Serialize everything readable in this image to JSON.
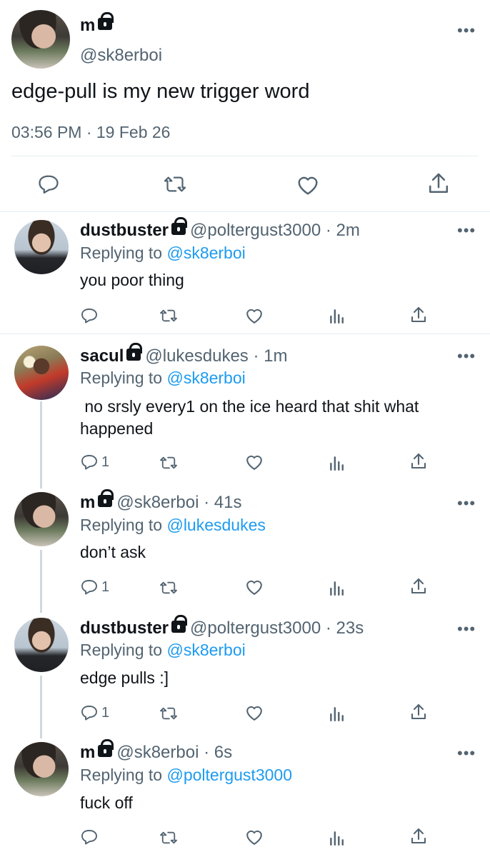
{
  "main_tweet": {
    "name": "m",
    "handle": "@sk8erboi",
    "text": "edge-pull is my new trigger word",
    "timestamp": "03:56 PM · 19 Feb 26"
  },
  "replies": [
    {
      "name": "dustbuster",
      "handle": "@poltergust3000 · 2m",
      "replying_label": "Replying to",
      "replying_to": "@sk8erboi",
      "text": "you poor thing",
      "reply_count": ""
    },
    {
      "name": "sacul",
      "handle": "@lukesdukes · 1m",
      "replying_label": "Replying to",
      "replying_to": "@sk8erboi",
      "text_line1": " no srsly every1 on the ice heard that shit what",
      "text_line2": "happened",
      "reply_count": "1"
    },
    {
      "name": "m",
      "handle": "@sk8erboi · 41s",
      "replying_label": "Replying to",
      "replying_to": "@lukesdukes",
      "text": "don’t ask",
      "reply_count": "1"
    },
    {
      "name": "dustbuster",
      "handle": "@poltergust3000 · 23s",
      "replying_label": "Replying to",
      "replying_to": "@sk8erboi",
      "text": "edge pulls :]",
      "reply_count": "1"
    },
    {
      "name": "m",
      "handle": "@sk8erboi · 6s",
      "replying_label": "Replying to",
      "replying_to": "@poltergust3000",
      "text": "fuck off",
      "reply_count": ""
    }
  ],
  "more_glyph": "•••",
  "icons": {
    "reply": "reply-icon",
    "retweet": "retweet-icon",
    "like": "heart-icon",
    "views": "views-icon",
    "share": "share-icon",
    "lock": "lock-icon"
  },
  "colors": {
    "link": "#1d9bf0",
    "secondary": "#536471",
    "text": "#0f1419"
  }
}
